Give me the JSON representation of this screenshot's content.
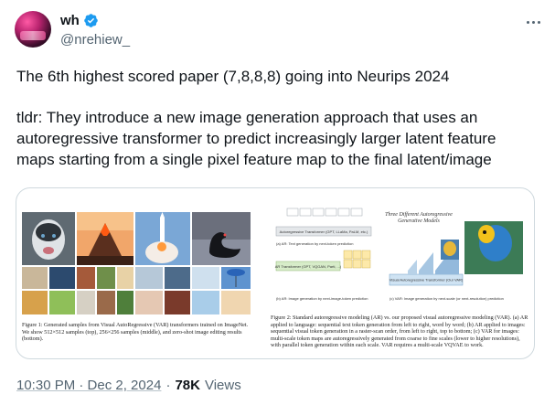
{
  "author": {
    "display_name": "wh",
    "handle": "@nrehiew_"
  },
  "tweet": {
    "line1": "The 6th highest scored paper (7,8,8,8) going into Neurips 2024",
    "line2": "tldr: They introduce a new image generation approach that uses an\nautoregressive transformer to predict increasingly larger latent feature\nmaps starting from a single pixel feature map to the final latent/image"
  },
  "media": {
    "left_caption": "Figure 1: Generated samples from Visual AutoRegressive (VAR) transformers trained on ImageNet. We show 512×512 samples (top), 256×256 samples (middle), and zero-shot image editing results (bottom).",
    "right_title": "Three Different Autoregressive Generative Models",
    "right_caption": "Figure 2: Standard autoregressive modeling (AR) vs. our proposed visual autoregressive modeling (VAR). (a) AR applied to language: sequential text token generation from left to right, word by word; (b) AR applied to images: sequential visual token generation in a raster-scan order, from left to right, top to bottom; (c) VAR for images: multi-scale token maps are autoregressively generated from coarse to fine scales (lower to higher resolutions), with parallel token generation within each scale. VAR requires a multi-scale VQVAE to work.",
    "diagram_labels": {
      "a": "(a) AR: Text generation by next-token prediction",
      "b": "(b) AR: Image generation by next-image-token prediction",
      "c": "(c) VAR: Image generation by next-scale (or next-resolution) prediction",
      "ar_transformer": "Autoregressive Transformer (GPT, LLaMa, PaLM, etc.)",
      "ar_transformer_b": "AR Transformer (GPT, VQGAN, Parti, ...)",
      "var_transformer": "Visual Autoregressive Transformer (Our VAR)"
    }
  },
  "meta": {
    "time": "10:30 PM · Dec 2, 2024",
    "separator": "·",
    "views_count": "78K",
    "views_label": "Views"
  },
  "colors": {
    "text": "#0f1419",
    "secondary": "#536471",
    "verified": "#1d9bf0",
    "border": "#cfd9de"
  }
}
